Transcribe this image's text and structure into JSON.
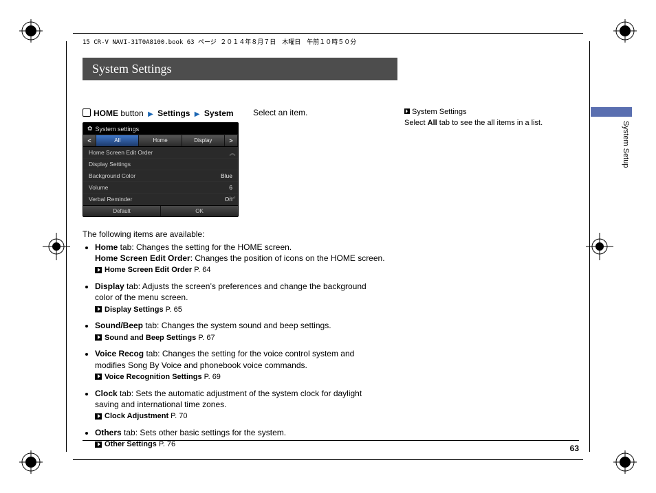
{
  "header_filename": "15 CR-V NAVI-31T0A8100.book  63 ページ  ２０１４年８月７日　木曜日　午前１０時５０分",
  "title": "System Settings",
  "breadcrumb": {
    "home": "HOME",
    "button_word": "button",
    "settings": "Settings",
    "system": "System"
  },
  "select_line": "Select an item.",
  "device": {
    "title": "System settings",
    "tabs": [
      "All",
      "Home",
      "Display"
    ],
    "rows": [
      {
        "label": "Home Screen Edit Order",
        "value": ""
      },
      {
        "label": "Display Settings",
        "value": ""
      },
      {
        "label": "Background Color",
        "value": "Blue"
      },
      {
        "label": "Volume",
        "value": "6"
      },
      {
        "label": "Verbal Reminder",
        "value": "On"
      }
    ],
    "footer": {
      "left": "Default",
      "right": "OK"
    }
  },
  "intro": "The following items are available:",
  "items": [
    {
      "lead_bold": "Home",
      "lead_rest": " tab: Changes the setting for the HOME screen.",
      "line2_bold": "Home Screen Edit Order",
      "line2_rest": ": Changes the position of icons on the HOME screen.",
      "xref": "Home Screen Edit Order",
      "xpage": "P. 64"
    },
    {
      "lead_bold": "Display",
      "lead_rest": " tab: Adjusts the screen’s preferences and change the background color of the menu screen.",
      "xref": "Display Settings",
      "xpage": "P. 65"
    },
    {
      "lead_bold": "Sound/Beep",
      "lead_rest": " tab: Changes the system sound and beep settings.",
      "xref": "Sound and Beep Settings",
      "xpage": "P. 67"
    },
    {
      "lead_bold": "Voice Recog",
      "lead_rest": " tab: Changes the setting for the voice control system and modifies Song By Voice and phonebook voice commands.",
      "xref": "Voice Recognition Settings",
      "xpage": "P. 69"
    },
    {
      "lead_bold": "Clock",
      "lead_rest": " tab: Sets the automatic adjustment of the system clock for daylight saving and international time zones.",
      "xref": "Clock Adjustment",
      "xpage": "P. 70"
    },
    {
      "lead_bold": "Others",
      "lead_rest": " tab: Sets other basic settings for the system.",
      "xref": "Other Settings",
      "xpage": "P. 76"
    }
  ],
  "side": {
    "heading": "System Settings",
    "body_pre": "Select ",
    "body_bold": "All",
    "body_post": " tab to see the all items in a list."
  },
  "side_tab": "System Setup",
  "page_number": "63"
}
